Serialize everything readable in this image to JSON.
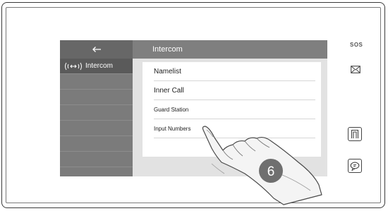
{
  "screen": {
    "back_icon": "arrow-left-icon",
    "header_title": "Intercom",
    "sidebar": {
      "items": [
        {
          "label": "Intercom",
          "icon": "intercom-icon",
          "active": true
        }
      ]
    },
    "list": {
      "items": [
        {
          "label": "Namelist"
        },
        {
          "label": "Inner Call"
        },
        {
          "label": "Guard Station"
        },
        {
          "label": "Input Numbers"
        }
      ]
    }
  },
  "device": {
    "buttons": [
      {
        "label": "SOS",
        "icon": "sos-icon"
      },
      {
        "icon": "message-icon"
      },
      {
        "icon": "unlock-icon"
      },
      {
        "icon": "talk-icon"
      }
    ]
  },
  "step_marker": "6",
  "colors": {
    "sidebar": "#7b7b7b",
    "header": "#7f7f7f",
    "active_item": "#5a5a5a",
    "step_circle": "#6f6f6f"
  }
}
